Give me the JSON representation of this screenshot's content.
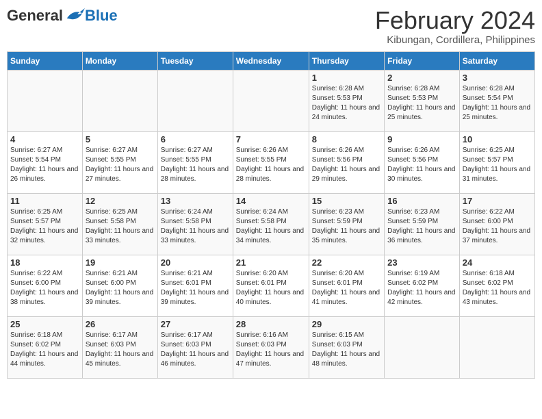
{
  "header": {
    "logo": {
      "general": "General",
      "blue": "Blue"
    },
    "title": "February 2024",
    "subtitle": "Kibungan, Cordillera, Philippines"
  },
  "days_of_week": [
    "Sunday",
    "Monday",
    "Tuesday",
    "Wednesday",
    "Thursday",
    "Friday",
    "Saturday"
  ],
  "weeks": [
    [
      {
        "day": "",
        "info": ""
      },
      {
        "day": "",
        "info": ""
      },
      {
        "day": "",
        "info": ""
      },
      {
        "day": "",
        "info": ""
      },
      {
        "day": "1",
        "info": "Sunrise: 6:28 AM\nSunset: 5:53 PM\nDaylight: 11 hours and 24 minutes."
      },
      {
        "day": "2",
        "info": "Sunrise: 6:28 AM\nSunset: 5:53 PM\nDaylight: 11 hours and 25 minutes."
      },
      {
        "day": "3",
        "info": "Sunrise: 6:28 AM\nSunset: 5:54 PM\nDaylight: 11 hours and 25 minutes."
      }
    ],
    [
      {
        "day": "4",
        "info": "Sunrise: 6:27 AM\nSunset: 5:54 PM\nDaylight: 11 hours and 26 minutes."
      },
      {
        "day": "5",
        "info": "Sunrise: 6:27 AM\nSunset: 5:55 PM\nDaylight: 11 hours and 27 minutes."
      },
      {
        "day": "6",
        "info": "Sunrise: 6:27 AM\nSunset: 5:55 PM\nDaylight: 11 hours and 28 minutes."
      },
      {
        "day": "7",
        "info": "Sunrise: 6:26 AM\nSunset: 5:55 PM\nDaylight: 11 hours and 28 minutes."
      },
      {
        "day": "8",
        "info": "Sunrise: 6:26 AM\nSunset: 5:56 PM\nDaylight: 11 hours and 29 minutes."
      },
      {
        "day": "9",
        "info": "Sunrise: 6:26 AM\nSunset: 5:56 PM\nDaylight: 11 hours and 30 minutes."
      },
      {
        "day": "10",
        "info": "Sunrise: 6:25 AM\nSunset: 5:57 PM\nDaylight: 11 hours and 31 minutes."
      }
    ],
    [
      {
        "day": "11",
        "info": "Sunrise: 6:25 AM\nSunset: 5:57 PM\nDaylight: 11 hours and 32 minutes."
      },
      {
        "day": "12",
        "info": "Sunrise: 6:25 AM\nSunset: 5:58 PM\nDaylight: 11 hours and 33 minutes."
      },
      {
        "day": "13",
        "info": "Sunrise: 6:24 AM\nSunset: 5:58 PM\nDaylight: 11 hours and 33 minutes."
      },
      {
        "day": "14",
        "info": "Sunrise: 6:24 AM\nSunset: 5:58 PM\nDaylight: 11 hours and 34 minutes."
      },
      {
        "day": "15",
        "info": "Sunrise: 6:23 AM\nSunset: 5:59 PM\nDaylight: 11 hours and 35 minutes."
      },
      {
        "day": "16",
        "info": "Sunrise: 6:23 AM\nSunset: 5:59 PM\nDaylight: 11 hours and 36 minutes."
      },
      {
        "day": "17",
        "info": "Sunrise: 6:22 AM\nSunset: 6:00 PM\nDaylight: 11 hours and 37 minutes."
      }
    ],
    [
      {
        "day": "18",
        "info": "Sunrise: 6:22 AM\nSunset: 6:00 PM\nDaylight: 11 hours and 38 minutes."
      },
      {
        "day": "19",
        "info": "Sunrise: 6:21 AM\nSunset: 6:00 PM\nDaylight: 11 hours and 39 minutes."
      },
      {
        "day": "20",
        "info": "Sunrise: 6:21 AM\nSunset: 6:01 PM\nDaylight: 11 hours and 39 minutes."
      },
      {
        "day": "21",
        "info": "Sunrise: 6:20 AM\nSunset: 6:01 PM\nDaylight: 11 hours and 40 minutes."
      },
      {
        "day": "22",
        "info": "Sunrise: 6:20 AM\nSunset: 6:01 PM\nDaylight: 11 hours and 41 minutes."
      },
      {
        "day": "23",
        "info": "Sunrise: 6:19 AM\nSunset: 6:02 PM\nDaylight: 11 hours and 42 minutes."
      },
      {
        "day": "24",
        "info": "Sunrise: 6:18 AM\nSunset: 6:02 PM\nDaylight: 11 hours and 43 minutes."
      }
    ],
    [
      {
        "day": "25",
        "info": "Sunrise: 6:18 AM\nSunset: 6:02 PM\nDaylight: 11 hours and 44 minutes."
      },
      {
        "day": "26",
        "info": "Sunrise: 6:17 AM\nSunset: 6:03 PM\nDaylight: 11 hours and 45 minutes."
      },
      {
        "day": "27",
        "info": "Sunrise: 6:17 AM\nSunset: 6:03 PM\nDaylight: 11 hours and 46 minutes."
      },
      {
        "day": "28",
        "info": "Sunrise: 6:16 AM\nSunset: 6:03 PM\nDaylight: 11 hours and 47 minutes."
      },
      {
        "day": "29",
        "info": "Sunrise: 6:15 AM\nSunset: 6:03 PM\nDaylight: 11 hours and 48 minutes."
      },
      {
        "day": "",
        "info": ""
      },
      {
        "day": "",
        "info": ""
      }
    ]
  ]
}
